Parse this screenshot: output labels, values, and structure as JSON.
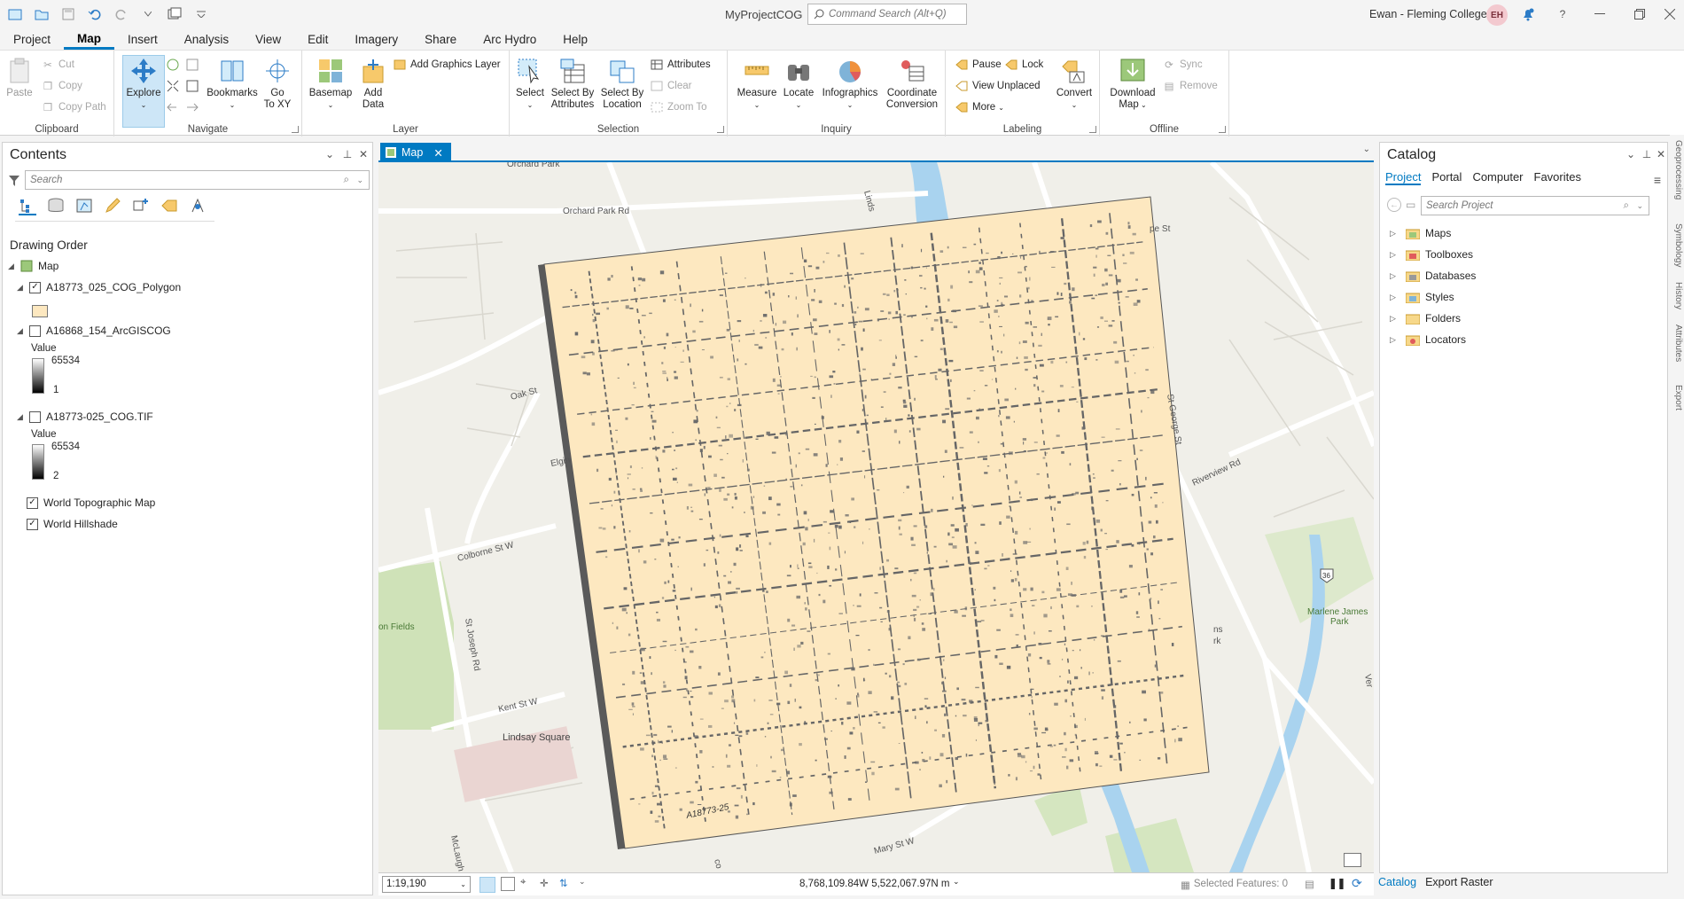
{
  "app": {
    "title": "MyProjectCOG",
    "command_search_placeholder": "Command Search (Alt+Q)",
    "user": "Ewan - Fleming College",
    "user_initials": "EH"
  },
  "menu_tabs": [
    "Project",
    "Map",
    "Insert",
    "Analysis",
    "View",
    "Edit",
    "Imagery",
    "Share",
    "Arc Hydro",
    "Help"
  ],
  "ribbon": {
    "clipboard": {
      "label": "Clipboard",
      "paste": "Paste",
      "cut": "Cut",
      "copy": "Copy",
      "copy_path": "Copy Path"
    },
    "navigate": {
      "label": "Navigate",
      "explore": "Explore",
      "bookmarks": "Bookmarks",
      "go_to_xy_1": "Go",
      "go_to_xy_2": "To XY"
    },
    "layer": {
      "label": "Layer",
      "basemap": "Basemap",
      "add_data_1": "Add",
      "add_data_2": "Data",
      "add_graphics_layer": "Add Graphics Layer"
    },
    "selection": {
      "label": "Selection",
      "select": "Select",
      "select_by_attributes_1": "Select By",
      "select_by_attributes_2": "Attributes",
      "select_by_location_1": "Select By",
      "select_by_location_2": "Location",
      "attributes": "Attributes",
      "clear": "Clear",
      "zoom_to": "Zoom To"
    },
    "inquiry": {
      "label": "Inquiry",
      "measure": "Measure",
      "locate": "Locate",
      "infographics": "Infographics",
      "coordinate_conversion_1": "Coordinate",
      "coordinate_conversion_2": "Conversion"
    },
    "labeling": {
      "label": "Labeling",
      "pause": "Pause",
      "lock": "Lock",
      "view_unplaced": "View Unplaced",
      "more": "More",
      "convert": "Convert"
    },
    "offline": {
      "label": "Offline",
      "download_map_1": "Download",
      "download_map_2": "Map",
      "sync": "Sync",
      "remove": "Remove"
    }
  },
  "contents": {
    "title": "Contents",
    "search_placeholder": "Search",
    "drawing_order": "Drawing Order",
    "map_label": "Map",
    "layers": [
      {
        "name": "A18773_025_COG_Polygon",
        "checked": true
      },
      {
        "name": "A16868_154_ArcGISCOG",
        "checked": false,
        "value_label": "Value",
        "max": "65534",
        "min": "1"
      },
      {
        "name": "A18773-025_COG.TIF",
        "checked": false,
        "value_label": "Value",
        "max": "65534",
        "min": "2"
      },
      {
        "name": "World Topographic Map",
        "checked": true
      },
      {
        "name": "World Hillshade",
        "checked": true
      }
    ]
  },
  "map_view": {
    "tab_label": "Map",
    "labels": {
      "orchard_park": "Orchard Park",
      "orchard_park_rd": "Orchard Park Rd",
      "oak_st": "Oak St",
      "elgin": "Elgin",
      "colborne": "Colborne St W",
      "on_fields": "on Fields",
      "st_joseph": "St Joseph Rd",
      "kent_st": "Kent St W",
      "lindsay_square": "Lindsay Square",
      "mclaugh": "McLaugh",
      "mary_st": "Mary St W",
      "st_george": "St George St",
      "riverview": "Riverview Rd",
      "marlene_1": "Marlene James",
      "marlene_2": "Park",
      "shield": "36",
      "lindsay_st": "Linds",
      "pe_st": "pe St",
      "ns": "ns",
      "rk": "rk",
      "ver": "Ver",
      "co": "co",
      "scan_label": "A18773-25"
    },
    "scale": "1:19,190",
    "coordinates": "8,768,109.84W 5,522,067.97N m",
    "selected_features": "Selected Features: 0"
  },
  "catalog": {
    "title": "Catalog",
    "tabs": [
      "Project",
      "Portal",
      "Computer",
      "Favorites"
    ],
    "search_placeholder": "Search Project",
    "items": [
      "Maps",
      "Toolboxes",
      "Databases",
      "Styles",
      "Folders",
      "Locators"
    ]
  },
  "bottom_tabs": [
    "Catalog",
    "Export Raster"
  ],
  "side_tabs": [
    "Geoprocessing",
    "Symbology",
    "History",
    "Attributes",
    "Export"
  ],
  "colors": {
    "accent": "#007ac2",
    "polygon_fill": "#fde8c0",
    "map_bg": "#f0efe9"
  }
}
